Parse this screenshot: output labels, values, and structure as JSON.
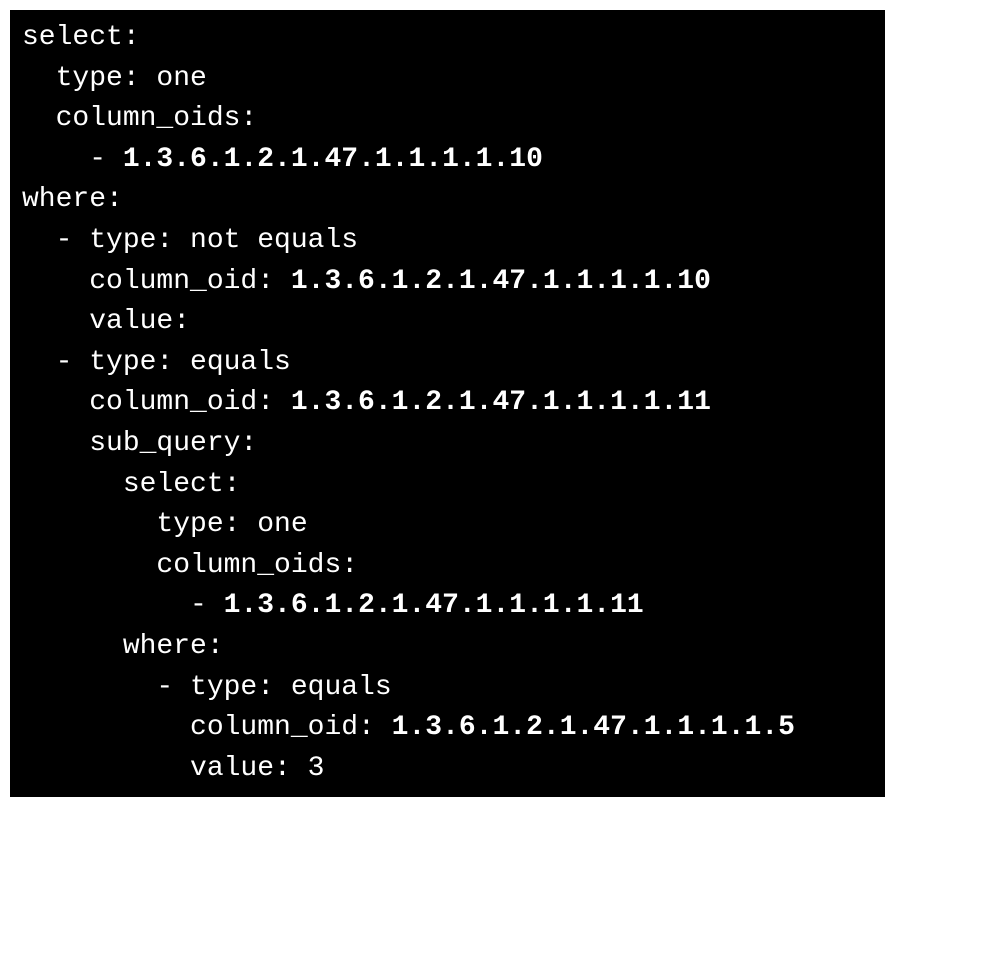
{
  "yaml": {
    "l0": "select:",
    "l1": "  type: one",
    "l2": "  column_oids:",
    "l3_prefix": "    - ",
    "l3_value": "1.3.6.1.2.1.47.1.1.1.1.10",
    "l4": "where:",
    "l5": "  - type: not equals",
    "l6_prefix": "    column_oid: ",
    "l6_value": "1.3.6.1.2.1.47.1.1.1.1.10",
    "l7": "    value:",
    "l8": "  - type: equals",
    "l9_prefix": "    column_oid: ",
    "l9_value": "1.3.6.1.2.1.47.1.1.1.1.11",
    "l10": "    sub_query:",
    "l11": "      select:",
    "l12": "        type: one",
    "l13": "        column_oids:",
    "l14_prefix": "          - ",
    "l14_value": "1.3.6.1.2.1.47.1.1.1.1.11",
    "l15": "      where:",
    "l16": "        - type: equals",
    "l17_prefix": "          column_oid: ",
    "l17_value": "1.3.6.1.2.1.47.1.1.1.1.5",
    "l18": "          value: 3"
  }
}
